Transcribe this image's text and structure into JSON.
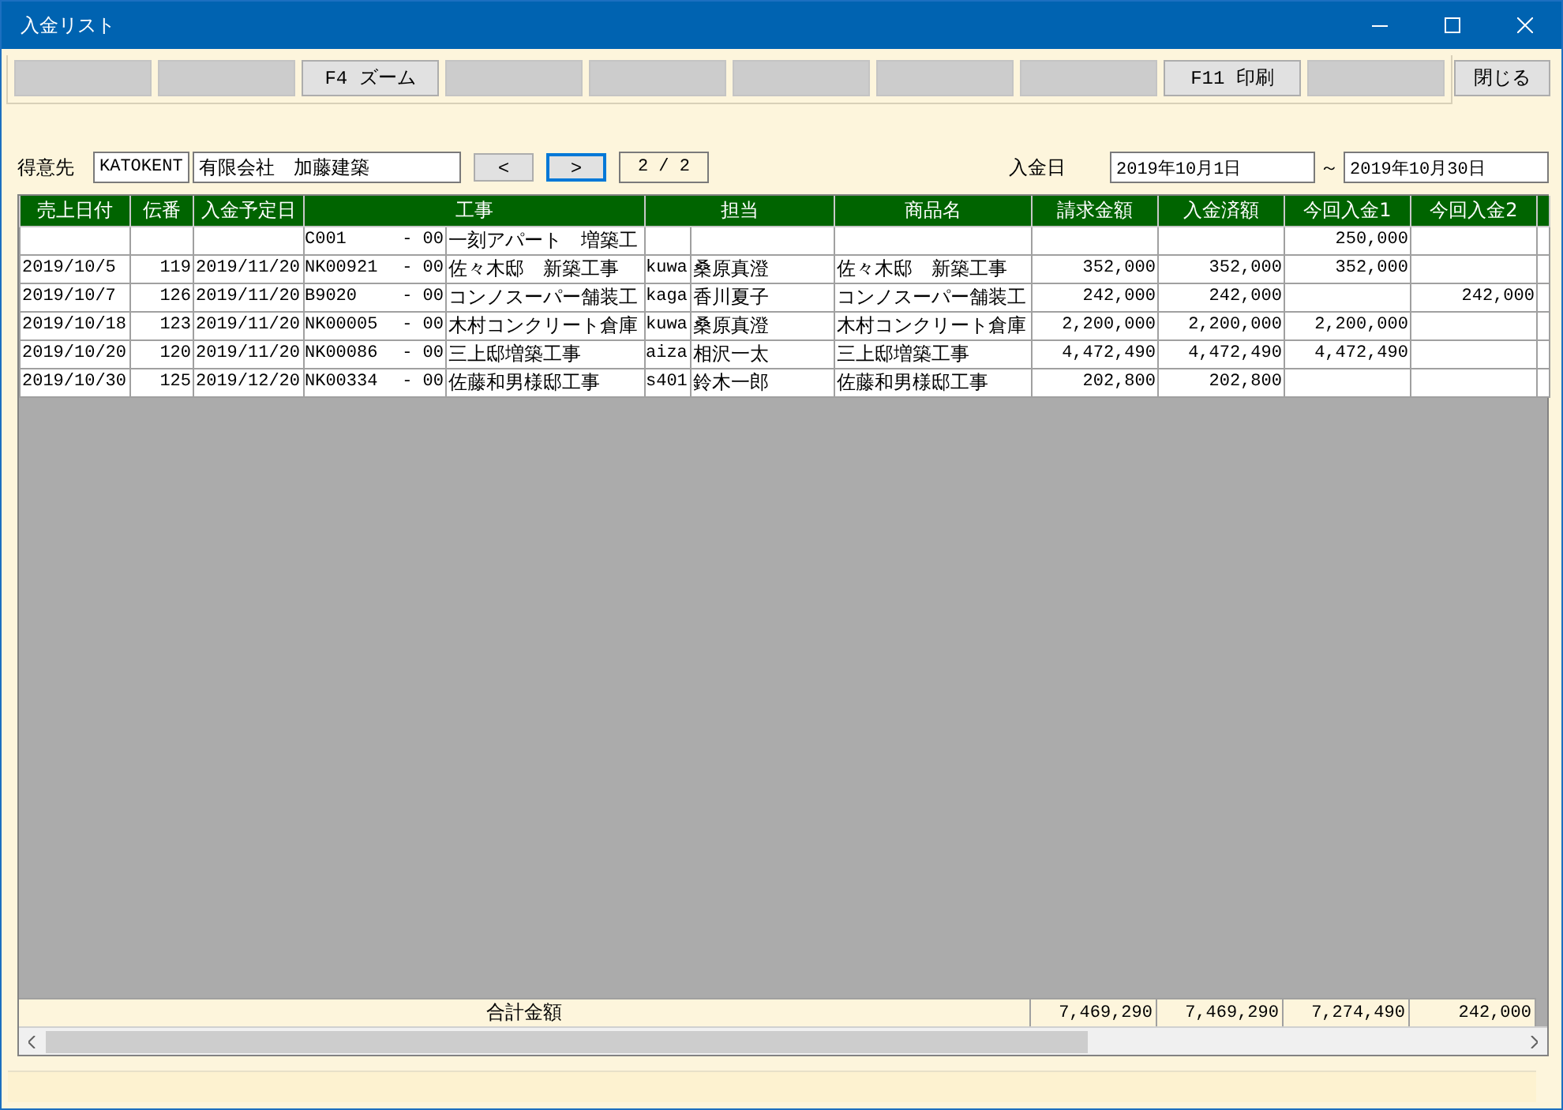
{
  "window": {
    "title": "入金リスト"
  },
  "toolbar": [
    {
      "disabled": true
    },
    {
      "disabled": true
    },
    {
      "label": "F4 ズーム",
      "disabled": false
    },
    {
      "disabled": true
    },
    {
      "disabled": true
    },
    {
      "disabled": true
    },
    {
      "disabled": true
    },
    {
      "disabled": true
    },
    {
      "label": "F11 印刷",
      "disabled": false
    },
    {
      "disabled": true
    }
  ],
  "close_button": "閉じる",
  "customer": {
    "label": "得意先",
    "code": "KATOKENT",
    "name": "有限会社　加藤建築"
  },
  "pager": {
    "prev": "<",
    "next": ">",
    "page": "2 / 2"
  },
  "date_range": {
    "label": "入金日",
    "from": "2019年10月1日",
    "separator": "～",
    "to": "2019年10月30日"
  },
  "table": {
    "columns": [
      "売上日付",
      "伝番",
      "入金予定日",
      "工事",
      "担当",
      "商品名",
      "請求金額",
      "入金済額",
      "今回入金1",
      "今回入金2"
    ],
    "rows": [
      {
        "project": {
          "code": "C001",
          "suffix": "- 00",
          "name": "一刻アパート　増築工"
        },
        "payment_1": "250,000"
      },
      {
        "sales_date": "2019/10/5",
        "no": "119",
        "due_date": "2019/11/20",
        "project": {
          "code": "NK00921",
          "suffix": "- 00",
          "name": "佐々木邸　新築工事"
        },
        "staff": {
          "code": "kuwa",
          "name": "桑原真澄"
        },
        "product": "佐々木邸　新築工事",
        "billed": "352,000",
        "paid": "352,000",
        "payment_1": "352,000"
      },
      {
        "sales_date": "2019/10/7",
        "no": "126",
        "due_date": "2019/11/20",
        "project": {
          "code": "B9020",
          "suffix": "- 00",
          "name": "コンノスーパー舗装工"
        },
        "staff": {
          "code": "kaga",
          "name": "香川夏子"
        },
        "product": "コンノスーパー舗装工",
        "billed": "242,000",
        "paid": "242,000",
        "payment_2": "242,000"
      },
      {
        "sales_date": "2019/10/18",
        "no": "123",
        "due_date": "2019/11/20",
        "project": {
          "code": "NK00005",
          "suffix": "- 00",
          "name": "木村コンクリート倉庫"
        },
        "staff": {
          "code": "kuwa",
          "name": "桑原真澄"
        },
        "product": "木村コンクリート倉庫",
        "billed": "2,200,000",
        "paid": "2,200,000",
        "payment_1": "2,200,000"
      },
      {
        "sales_date": "2019/10/20",
        "no": "120",
        "due_date": "2019/11/20",
        "project": {
          "code": "NK00086",
          "suffix": "- 00",
          "name": "三上邸増築工事"
        },
        "staff": {
          "code": "aiza",
          "name": "相沢一太"
        },
        "product": "三上邸増築工事",
        "billed": "4,472,490",
        "paid": "4,472,490",
        "payment_1": "4,472,490"
      },
      {
        "sales_date": "2019/10/30",
        "no": "125",
        "due_date": "2019/12/20",
        "project": {
          "code": "NK00334",
          "suffix": "- 00",
          "name": "佐藤和男様邸工事"
        },
        "staff": {
          "code": "s401",
          "name": "鈴木一郎"
        },
        "product": "佐藤和男様邸工事",
        "billed": "202,800",
        "paid": "202,800"
      }
    ],
    "total": {
      "label": "合計金額",
      "values": [
        "7,469,290",
        "7,469,290",
        "7,274,490",
        "242,000"
      ]
    }
  }
}
